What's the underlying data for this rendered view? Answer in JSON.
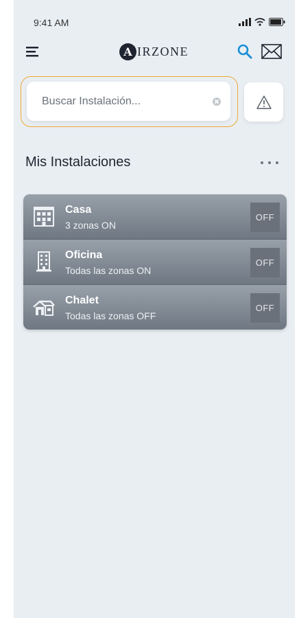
{
  "status_bar": {
    "time": "9:41 AM"
  },
  "nav": {
    "logo_letter": "A",
    "logo_text": "IRZONE"
  },
  "search": {
    "placeholder": "Buscar Instalación..."
  },
  "section": {
    "title": "Mis Instalaciones"
  },
  "installations": [
    {
      "name": "Casa",
      "status": "3 zonas ON",
      "button": "OFF",
      "icon": "building-icon"
    },
    {
      "name": "Oficina",
      "status": "Todas las zonas ON",
      "button": "OFF",
      "icon": "office-tower-icon"
    },
    {
      "name": "Chalet",
      "status": "Todas las zonas OFF",
      "button": "OFF",
      "icon": "house-icon"
    }
  ],
  "colors": {
    "accent": "#1a8fd6",
    "search_focus": "#f0a830",
    "row_bg": "#7d8590"
  }
}
